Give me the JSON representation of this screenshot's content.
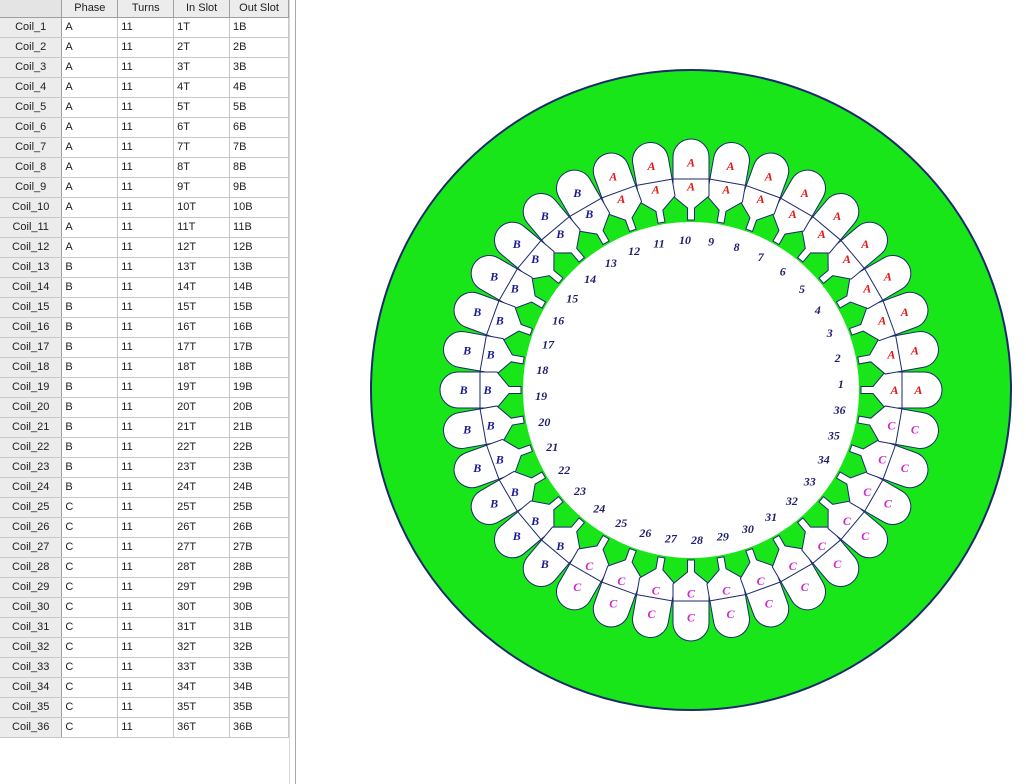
{
  "grid": {
    "columns": [
      "",
      "Phase",
      "Turns",
      "In Slot",
      "Out Slot"
    ],
    "rows": [
      {
        "name": "Coil_1",
        "phase": "A",
        "turns": "11",
        "in_slot": "1T",
        "out_slot": "1B"
      },
      {
        "name": "Coil_2",
        "phase": "A",
        "turns": "11",
        "in_slot": "2T",
        "out_slot": "2B"
      },
      {
        "name": "Coil_3",
        "phase": "A",
        "turns": "11",
        "in_slot": "3T",
        "out_slot": "3B"
      },
      {
        "name": "Coil_4",
        "phase": "A",
        "turns": "11",
        "in_slot": "4T",
        "out_slot": "4B"
      },
      {
        "name": "Coil_5",
        "phase": "A",
        "turns": "11",
        "in_slot": "5T",
        "out_slot": "5B"
      },
      {
        "name": "Coil_6",
        "phase": "A",
        "turns": "11",
        "in_slot": "6T",
        "out_slot": "6B"
      },
      {
        "name": "Coil_7",
        "phase": "A",
        "turns": "11",
        "in_slot": "7T",
        "out_slot": "7B"
      },
      {
        "name": "Coil_8",
        "phase": "A",
        "turns": "11",
        "in_slot": "8T",
        "out_slot": "8B"
      },
      {
        "name": "Coil_9",
        "phase": "A",
        "turns": "11",
        "in_slot": "9T",
        "out_slot": "9B"
      },
      {
        "name": "Coil_10",
        "phase": "A",
        "turns": "11",
        "in_slot": "10T",
        "out_slot": "10B"
      },
      {
        "name": "Coil_11",
        "phase": "A",
        "turns": "11",
        "in_slot": "11T",
        "out_slot": "11B"
      },
      {
        "name": "Coil_12",
        "phase": "A",
        "turns": "11",
        "in_slot": "12T",
        "out_slot": "12B"
      },
      {
        "name": "Coil_13",
        "phase": "B",
        "turns": "11",
        "in_slot": "13T",
        "out_slot": "13B"
      },
      {
        "name": "Coil_14",
        "phase": "B",
        "turns": "11",
        "in_slot": "14T",
        "out_slot": "14B"
      },
      {
        "name": "Coil_15",
        "phase": "B",
        "turns": "11",
        "in_slot": "15T",
        "out_slot": "15B"
      },
      {
        "name": "Coil_16",
        "phase": "B",
        "turns": "11",
        "in_slot": "16T",
        "out_slot": "16B"
      },
      {
        "name": "Coil_17",
        "phase": "B",
        "turns": "11",
        "in_slot": "17T",
        "out_slot": "17B"
      },
      {
        "name": "Coil_18",
        "phase": "B",
        "turns": "11",
        "in_slot": "18T",
        "out_slot": "18B"
      },
      {
        "name": "Coil_19",
        "phase": "B",
        "turns": "11",
        "in_slot": "19T",
        "out_slot": "19B"
      },
      {
        "name": "Coil_20",
        "phase": "B",
        "turns": "11",
        "in_slot": "20T",
        "out_slot": "20B"
      },
      {
        "name": "Coil_21",
        "phase": "B",
        "turns": "11",
        "in_slot": "21T",
        "out_slot": "21B"
      },
      {
        "name": "Coil_22",
        "phase": "B",
        "turns": "11",
        "in_slot": "22T",
        "out_slot": "22B"
      },
      {
        "name": "Coil_23",
        "phase": "B",
        "turns": "11",
        "in_slot": "23T",
        "out_slot": "23B"
      },
      {
        "name": "Coil_24",
        "phase": "B",
        "turns": "11",
        "in_slot": "24T",
        "out_slot": "24B"
      },
      {
        "name": "Coil_25",
        "phase": "C",
        "turns": "11",
        "in_slot": "25T",
        "out_slot": "25B"
      },
      {
        "name": "Coil_26",
        "phase": "C",
        "turns": "11",
        "in_slot": "26T",
        "out_slot": "26B"
      },
      {
        "name": "Coil_27",
        "phase": "C",
        "turns": "11",
        "in_slot": "27T",
        "out_slot": "27B"
      },
      {
        "name": "Coil_28",
        "phase": "C",
        "turns": "11",
        "in_slot": "28T",
        "out_slot": "28B"
      },
      {
        "name": "Coil_29",
        "phase": "C",
        "turns": "11",
        "in_slot": "29T",
        "out_slot": "29B"
      },
      {
        "name": "Coil_30",
        "phase": "C",
        "turns": "11",
        "in_slot": "30T",
        "out_slot": "30B"
      },
      {
        "name": "Coil_31",
        "phase": "C",
        "turns": "11",
        "in_slot": "31T",
        "out_slot": "31B"
      },
      {
        "name": "Coil_32",
        "phase": "C",
        "turns": "11",
        "in_slot": "32T",
        "out_slot": "32B"
      },
      {
        "name": "Coil_33",
        "phase": "C",
        "turns": "11",
        "in_slot": "33T",
        "out_slot": "33B"
      },
      {
        "name": "Coil_34",
        "phase": "C",
        "turns": "11",
        "in_slot": "34T",
        "out_slot": "34B"
      },
      {
        "name": "Coil_35",
        "phase": "C",
        "turns": "11",
        "in_slot": "35T",
        "out_slot": "35B"
      },
      {
        "name": "Coil_36",
        "phase": "C",
        "turns": "11",
        "in_slot": "36T",
        "out_slot": "36B"
      }
    ]
  },
  "stator": {
    "slot_count": 36,
    "slots": [
      {
        "number": "1",
        "top": "A",
        "bottom": "A"
      },
      {
        "number": "2",
        "top": "A",
        "bottom": "A"
      },
      {
        "number": "3",
        "top": "A",
        "bottom": "A"
      },
      {
        "number": "4",
        "top": "A",
        "bottom": "A"
      },
      {
        "number": "5",
        "top": "A",
        "bottom": "A"
      },
      {
        "number": "6",
        "top": "A",
        "bottom": "A"
      },
      {
        "number": "7",
        "top": "A",
        "bottom": "A"
      },
      {
        "number": "8",
        "top": "A",
        "bottom": "A"
      },
      {
        "number": "9",
        "top": "A",
        "bottom": "A"
      },
      {
        "number": "10",
        "top": "A",
        "bottom": "A"
      },
      {
        "number": "11",
        "top": "A",
        "bottom": "A"
      },
      {
        "number": "12",
        "top": "A",
        "bottom": "A"
      },
      {
        "number": "13",
        "top": "B",
        "bottom": "B"
      },
      {
        "number": "14",
        "top": "B",
        "bottom": "B"
      },
      {
        "number": "15",
        "top": "B",
        "bottom": "B"
      },
      {
        "number": "16",
        "top": "B",
        "bottom": "B"
      },
      {
        "number": "17",
        "top": "B",
        "bottom": "B"
      },
      {
        "number": "18",
        "top": "B",
        "bottom": "B"
      },
      {
        "number": "19",
        "top": "B",
        "bottom": "B"
      },
      {
        "number": "20",
        "top": "B",
        "bottom": "B"
      },
      {
        "number": "21",
        "top": "B",
        "bottom": "B"
      },
      {
        "number": "22",
        "top": "B",
        "bottom": "B"
      },
      {
        "number": "23",
        "top": "B",
        "bottom": "B"
      },
      {
        "number": "24",
        "top": "B",
        "bottom": "B"
      },
      {
        "number": "25",
        "top": "C",
        "bottom": "C"
      },
      {
        "number": "26",
        "top": "C",
        "bottom": "C"
      },
      {
        "number": "27",
        "top": "C",
        "bottom": "C"
      },
      {
        "number": "28",
        "top": "C",
        "bottom": "C"
      },
      {
        "number": "29",
        "top": "C",
        "bottom": "C"
      },
      {
        "number": "30",
        "top": "C",
        "bottom": "C"
      },
      {
        "number": "31",
        "top": "C",
        "bottom": "C"
      },
      {
        "number": "32",
        "top": "C",
        "bottom": "C"
      },
      {
        "number": "33",
        "top": "C",
        "bottom": "C"
      },
      {
        "number": "34",
        "top": "C",
        "bottom": "C"
      },
      {
        "number": "35",
        "top": "C",
        "bottom": "C"
      },
      {
        "number": "36",
        "top": "C",
        "bottom": "C"
      }
    ]
  },
  "colors": {
    "stator_fill": "#19e619",
    "stator_outline": "#1a2a6a",
    "slot_outline": "#1a2a6a",
    "phase_A": "#e01818",
    "phase_B": "#1a1a90",
    "phase_C": "#d028d0",
    "slot_number": "#1e1e6e"
  }
}
